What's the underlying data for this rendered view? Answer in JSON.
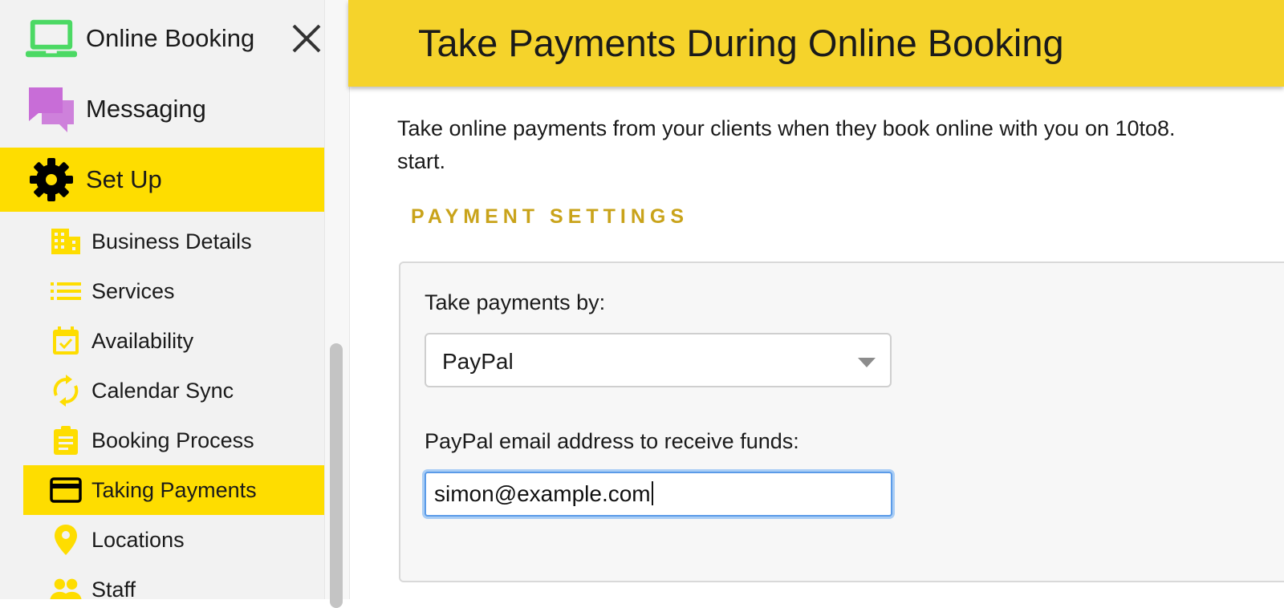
{
  "sidebar": {
    "top_items": [
      {
        "label": "Online Booking",
        "icon": "laptop-icon"
      },
      {
        "label": "Messaging",
        "icon": "chat-bubbles-icon"
      },
      {
        "label": "Set Up",
        "icon": "gear-icon",
        "active": true
      }
    ],
    "sub_items": [
      {
        "label": "Business Details",
        "icon": "building-icon"
      },
      {
        "label": "Services",
        "icon": "list-icon"
      },
      {
        "label": "Availability",
        "icon": "calendar-check-icon"
      },
      {
        "label": "Calendar Sync",
        "icon": "sync-icon"
      },
      {
        "label": "Booking Process",
        "icon": "clipboard-icon"
      },
      {
        "label": "Taking Payments",
        "icon": "credit-card-icon",
        "active": true
      },
      {
        "label": "Locations",
        "icon": "map-pin-icon"
      },
      {
        "label": "Staff",
        "icon": "people-icon"
      }
    ],
    "close_icon": "close-icon"
  },
  "header": {
    "title": "Take Payments During Online Booking"
  },
  "main": {
    "intro_line1": "Take online payments from your clients when they book online with you on 10to8.",
    "intro_line2": "start.",
    "section_title": "PAYMENT SETTINGS",
    "payment_method_label": "Take payments by:",
    "payment_method_value": "PayPal",
    "paypal_email_label": "PayPal email address to receive funds:",
    "paypal_email_value": "simon@example.com"
  },
  "colors": {
    "accent_yellow": "#fedd00",
    "header_yellow": "#f5d32b",
    "section_gold": "#c9a31a",
    "laptop_green": "#4cd964",
    "messaging_purple": "#c86dd7",
    "focus_blue": "#5b9be8"
  }
}
